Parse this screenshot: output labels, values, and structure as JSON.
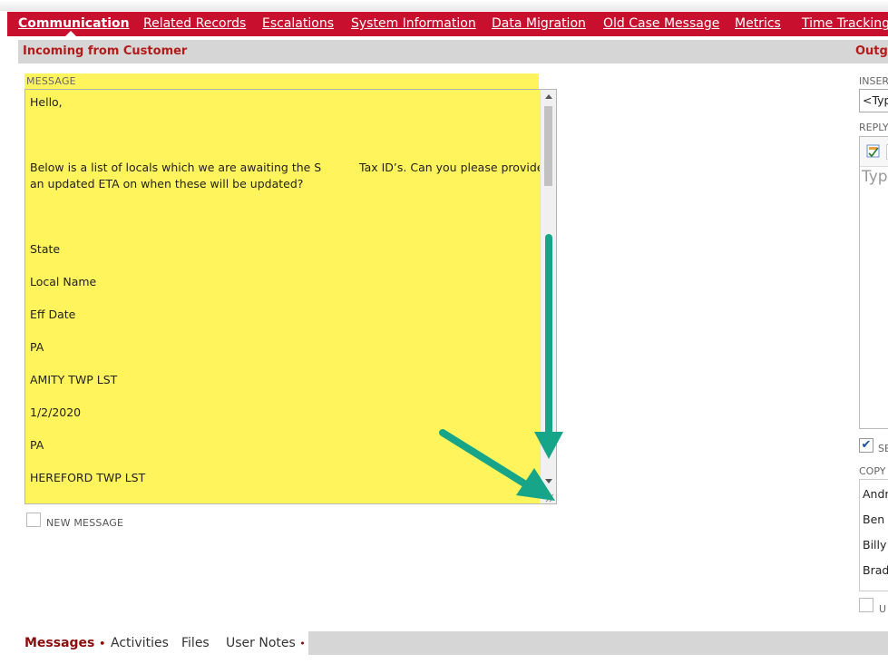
{
  "tabs": [
    {
      "label": "Communication",
      "active": true
    },
    {
      "label": "Related Records",
      "active": false
    },
    {
      "label": "Escalations",
      "active": false
    },
    {
      "label": "System Information",
      "active": false
    },
    {
      "label": "Data Migration",
      "active": false
    },
    {
      "label": "Old Case Message",
      "active": false
    },
    {
      "label": "Metrics",
      "active": false
    },
    {
      "label": "Time Tracking",
      "active": false
    }
  ],
  "incoming": {
    "section_title": "Incoming from Customer",
    "message_label": "MESSAGE",
    "message_lines": [
      "Hello,",
      "Below is a list of locals which we are awaiting the S",
      "Tax ID’s. Can you please provide",
      "an updated ETA on when these will be updated?",
      "State",
      "Local Name",
      "Eff Date",
      "PA",
      "AMITY TWP LST",
      "1/2/2020",
      "PA",
      "HEREFORD TWP LST"
    ],
    "new_message_label": "NEW MESSAGE"
  },
  "outgoing": {
    "section_title": "Outgo",
    "insert_label": "INSER",
    "insert_value": "<Typ",
    "reply_label": "REPLY",
    "reply_placeholder": "Type",
    "send_label": "SE",
    "copy_label": "COPY",
    "copy_items": [
      "Andr",
      "Ben",
      "Billy",
      "Brad"
    ],
    "use_label": "U"
  },
  "bottom_tabs": [
    {
      "label": "Messages",
      "active": true
    },
    {
      "label": "Activities",
      "active": false
    },
    {
      "label": "Files",
      "active": false
    },
    {
      "label": "User Notes",
      "active": false
    }
  ],
  "colors": {
    "tab_bar": "#c8102e",
    "highlight": "#fff45c",
    "annotation_arrow": "#17a589"
  }
}
